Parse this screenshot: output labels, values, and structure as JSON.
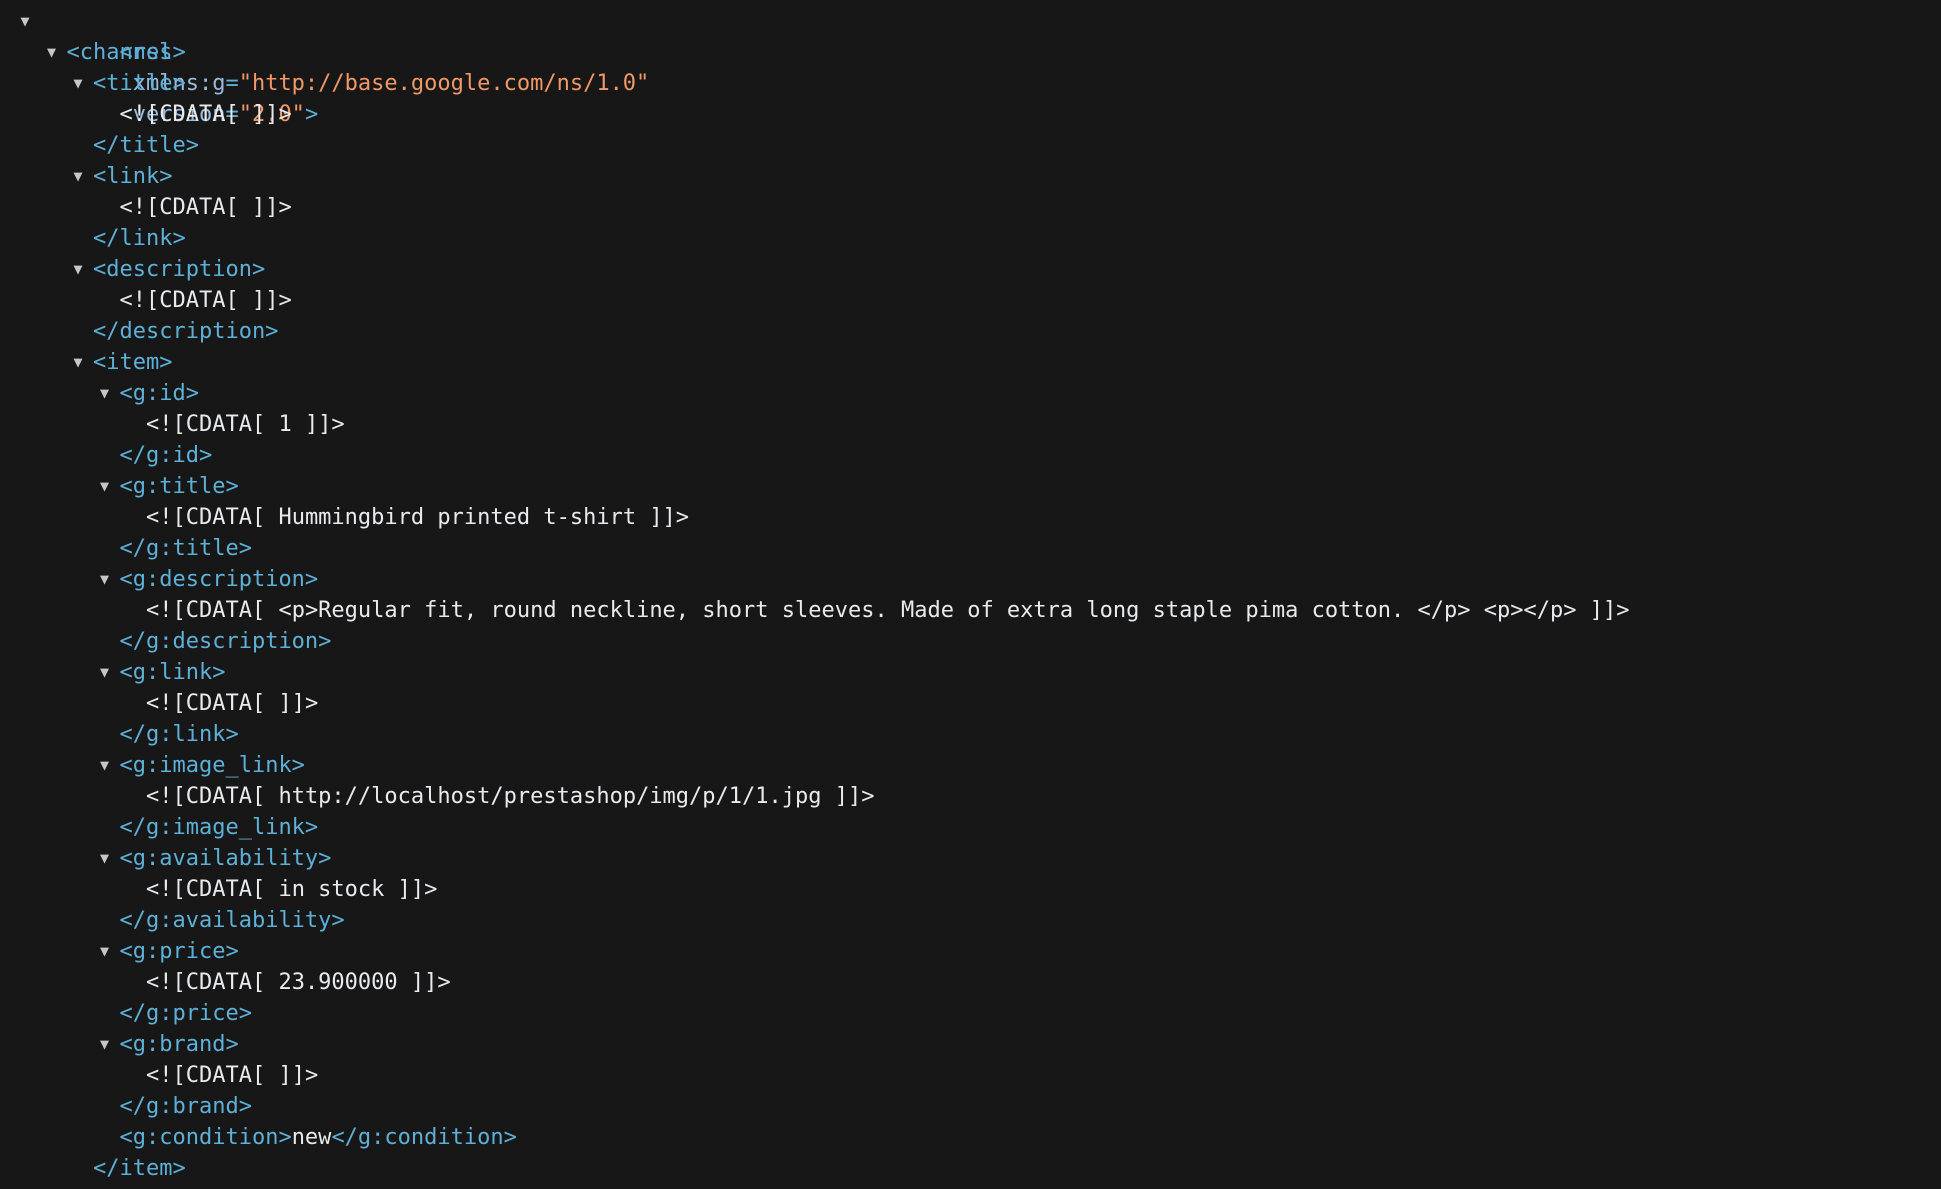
{
  "icons": {
    "expanded": "triangle-down-icon"
  },
  "rss": {
    "open_start": "<rss",
    "attrs": [
      {
        "name": "xmlns:g",
        "value": "\"http://base.google.com/ns/1.0\""
      },
      {
        "name": "version",
        "value": "\"2.0\""
      }
    ],
    "open_end": ">"
  },
  "lines": [
    {
      "depth": 1,
      "toggle": true,
      "kind": "tag",
      "text": "<channel>"
    },
    {
      "depth": 2,
      "toggle": true,
      "kind": "tag",
      "text": "<title>"
    },
    {
      "depth": 3,
      "toggle": false,
      "kind": "text",
      "text": "<![CDATA[ ]]>"
    },
    {
      "depth": 2,
      "toggle": false,
      "kind": "tag",
      "text": "</title>"
    },
    {
      "depth": 2,
      "toggle": true,
      "kind": "tag",
      "text": "<link>"
    },
    {
      "depth": 3,
      "toggle": false,
      "kind": "text",
      "text": "<![CDATA[ ]]>"
    },
    {
      "depth": 2,
      "toggle": false,
      "kind": "tag",
      "text": "</link>"
    },
    {
      "depth": 2,
      "toggle": true,
      "kind": "tag",
      "text": "<description>"
    },
    {
      "depth": 3,
      "toggle": false,
      "kind": "text",
      "text": "<![CDATA[ ]]>"
    },
    {
      "depth": 2,
      "toggle": false,
      "kind": "tag",
      "text": "</description>"
    },
    {
      "depth": 2,
      "toggle": true,
      "kind": "tag",
      "text": "<item>"
    },
    {
      "depth": 3,
      "toggle": true,
      "kind": "tag",
      "text": "<g:id>"
    },
    {
      "depth": 4,
      "toggle": false,
      "kind": "text",
      "text": "<![CDATA[ 1 ]]>"
    },
    {
      "depth": 3,
      "toggle": false,
      "kind": "tag",
      "text": "</g:id>"
    },
    {
      "depth": 3,
      "toggle": true,
      "kind": "tag",
      "text": "<g:title>"
    },
    {
      "depth": 4,
      "toggle": false,
      "kind": "text",
      "text": "<![CDATA[ Hummingbird printed t-shirt ]]>"
    },
    {
      "depth": 3,
      "toggle": false,
      "kind": "tag",
      "text": "</g:title>"
    },
    {
      "depth": 3,
      "toggle": true,
      "kind": "tag",
      "text": "<g:description>"
    },
    {
      "depth": 4,
      "toggle": false,
      "kind": "text",
      "text": "<![CDATA[ <p>Regular fit, round neckline, short sleeves. Made of extra long staple pima cotton. </p> <p></p> ]]>"
    },
    {
      "depth": 3,
      "toggle": false,
      "kind": "tag",
      "text": "</g:description>"
    },
    {
      "depth": 3,
      "toggle": true,
      "kind": "tag",
      "text": "<g:link>"
    },
    {
      "depth": 4,
      "toggle": false,
      "kind": "text",
      "text": "<![CDATA[ ]]>"
    },
    {
      "depth": 3,
      "toggle": false,
      "kind": "tag",
      "text": "</g:link>"
    },
    {
      "depth": 3,
      "toggle": true,
      "kind": "tag",
      "text": "<g:image_link>"
    },
    {
      "depth": 4,
      "toggle": false,
      "kind": "text",
      "text": "<![CDATA[ http://localhost/prestashop/img/p/1/1.jpg ]]>"
    },
    {
      "depth": 3,
      "toggle": false,
      "kind": "tag",
      "text": "</g:image_link>"
    },
    {
      "depth": 3,
      "toggle": true,
      "kind": "tag",
      "text": "<g:availability>"
    },
    {
      "depth": 4,
      "toggle": false,
      "kind": "text",
      "text": "<![CDATA[ in stock ]]>"
    },
    {
      "depth": 3,
      "toggle": false,
      "kind": "tag",
      "text": "</g:availability>"
    },
    {
      "depth": 3,
      "toggle": true,
      "kind": "tag",
      "text": "<g:price>"
    },
    {
      "depth": 4,
      "toggle": false,
      "kind": "text",
      "text": "<![CDATA[ 23.900000 ]]>"
    },
    {
      "depth": 3,
      "toggle": false,
      "kind": "tag",
      "text": "</g:price>"
    },
    {
      "depth": 3,
      "toggle": true,
      "kind": "tag",
      "text": "<g:brand>"
    },
    {
      "depth": 4,
      "toggle": false,
      "kind": "text",
      "text": "<![CDATA[ ]]>"
    },
    {
      "depth": 3,
      "toggle": false,
      "kind": "tag",
      "text": "</g:brand>"
    },
    {
      "depth": 3,
      "toggle": false,
      "kind": "inline",
      "open": "<g:condition>",
      "value": "new",
      "close": "</g:condition>"
    },
    {
      "depth": 2,
      "toggle": false,
      "kind": "tag",
      "text": "</item>"
    }
  ]
}
